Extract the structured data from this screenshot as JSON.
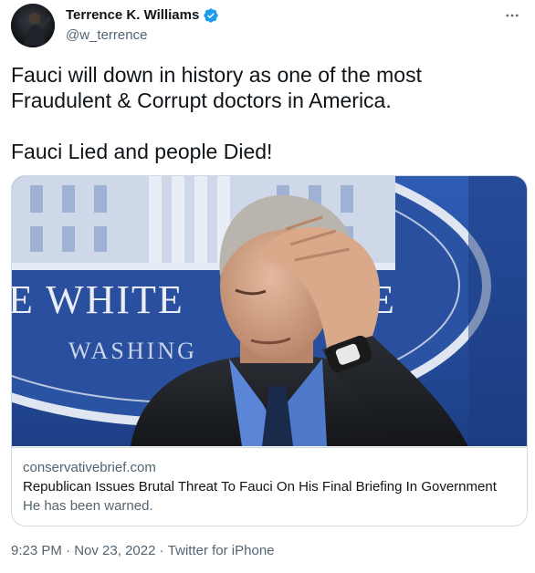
{
  "author": {
    "display_name": "Terrence K. Williams",
    "handle": "@w_terrence",
    "verified_icon": "verified-badge-icon"
  },
  "tweet": {
    "line1": "Fauci will down in history as one of the most",
    "line2": "Fraudulent & Corrupt doctors in America.",
    "line3": "Fauci Lied and people Died!"
  },
  "card": {
    "image_sign_line1": "E WHITE",
    "image_sign_line1b": "E",
    "image_sign_line2": "WASHING",
    "domain": "conservativebrief.com",
    "title": "Republican Issues Brutal Threat To Fauci On His Final Briefing In Government",
    "description": "He has been warned."
  },
  "footer": {
    "time": "9:23 PM",
    "separator": " · ",
    "date": "Nov 23, 2022",
    "source": "Twitter for iPhone"
  },
  "colors": {
    "verified": "#1d9bf0",
    "secondary_text": "#536471",
    "border": "#cfd9de",
    "backdrop_blue": "#2a4f9e"
  }
}
